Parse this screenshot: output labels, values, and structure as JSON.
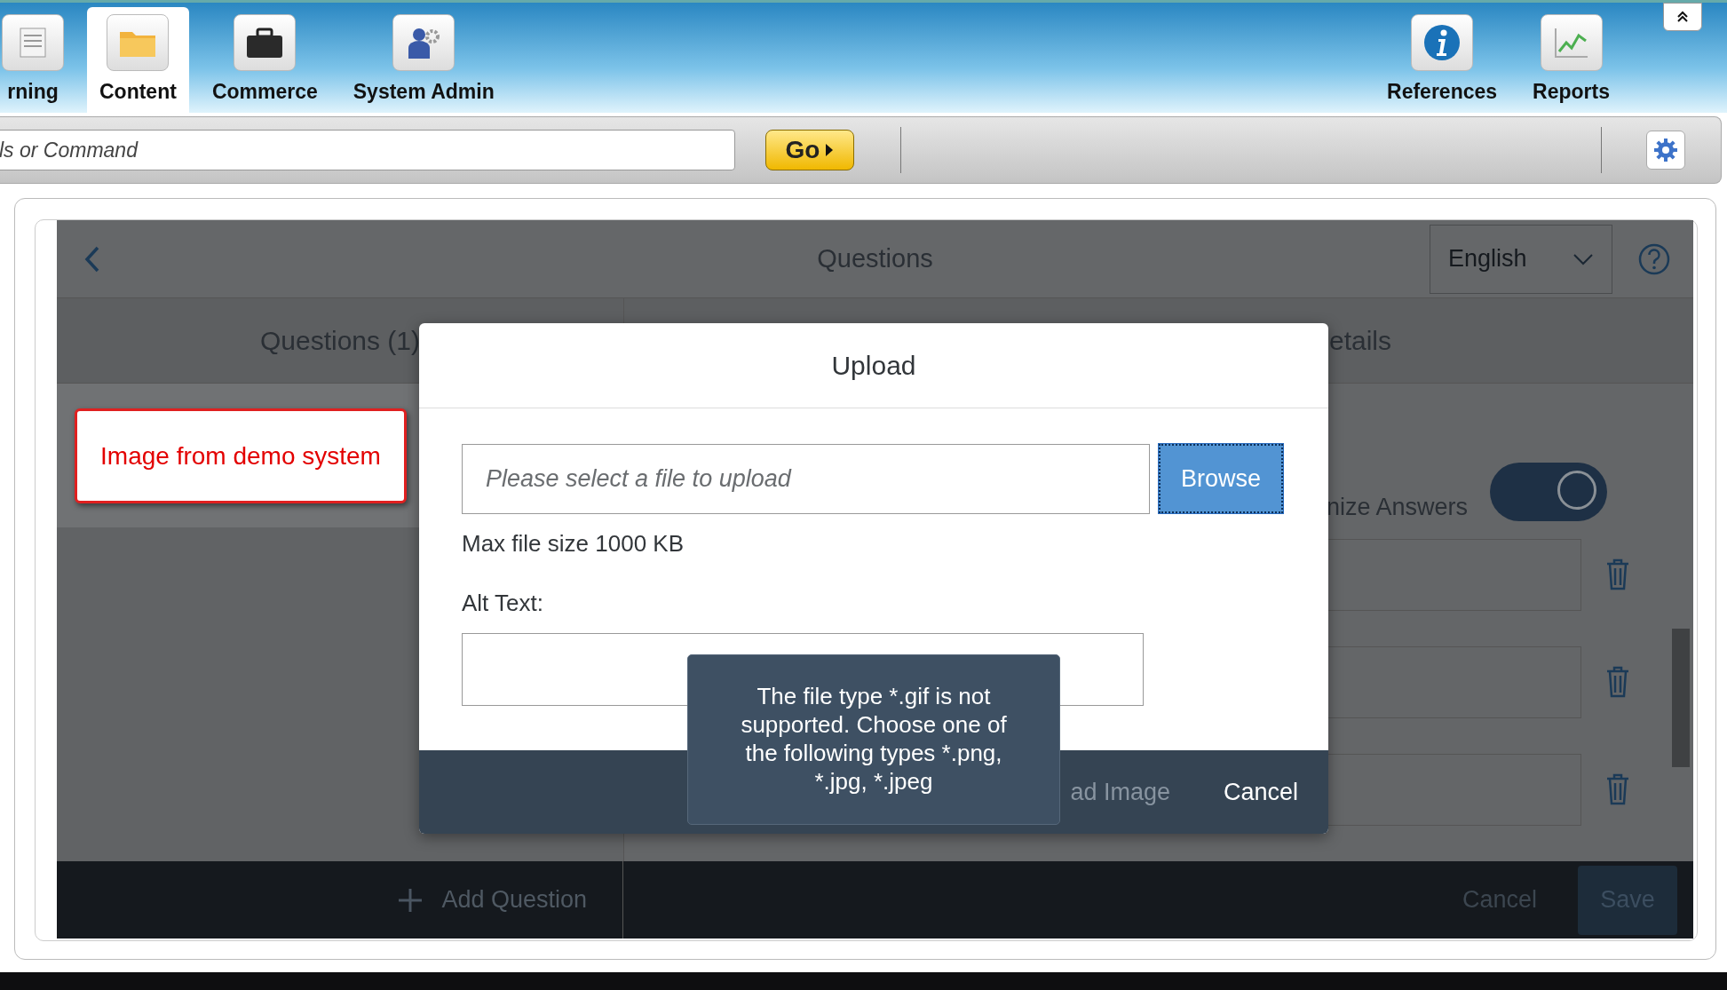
{
  "nav": {
    "items": [
      {
        "label": "rning",
        "selected": false
      },
      {
        "label": "Content",
        "selected": true
      },
      {
        "label": "Commerce",
        "selected": false
      },
      {
        "label": "System Admin",
        "selected": false
      }
    ],
    "right_items": [
      {
        "label": "References"
      },
      {
        "label": "Reports"
      }
    ]
  },
  "command_bar": {
    "placeholder": "ls or Command",
    "go_button": "Go"
  },
  "page": {
    "title": "Questions",
    "language": "English",
    "tabs": [
      {
        "label": "Questions (1)"
      },
      {
        "label": "etails"
      }
    ],
    "toggle": {
      "label": "nize Answers",
      "on": true
    }
  },
  "footer": {
    "add_button": "Add Question",
    "cancel": "Cancel",
    "save": "Save"
  },
  "dialog": {
    "title": "Upload",
    "file_placeholder": "Please select a file to upload",
    "browse": "Browse",
    "hint": "Max file size 1000 KB",
    "alt_label": "Alt Text:",
    "buttons": [
      {
        "label": "ad Image",
        "disabled": true
      },
      {
        "label": "Cancel",
        "disabled": false
      }
    ]
  },
  "tooltip": "The file type *.gif is not supported. Choose one of the following types *.png, *.jpg, *.jpeg",
  "annotation": "Image from demo system"
}
